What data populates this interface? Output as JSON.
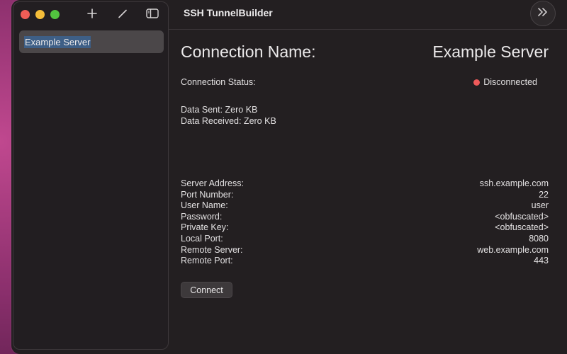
{
  "app": {
    "title": "SSH TunnelBuilder"
  },
  "sidebar": {
    "items": [
      {
        "label": "Example Server",
        "selected": true
      }
    ]
  },
  "detail": {
    "connection_name_label": "Connection Name:",
    "connection_name_value": "Example Server",
    "status_label": "Connection Status:",
    "status_value": "Disconnected",
    "status_color": "#ee5a5a",
    "data_sent": "Data Sent: Zero KB",
    "data_received": "Data Received: Zero KB",
    "fields": [
      {
        "label": "Server Address:",
        "value": "ssh.example.com"
      },
      {
        "label": "Port Number:",
        "value": "22"
      },
      {
        "label": "User Name:",
        "value": "user"
      },
      {
        "label": "Password:",
        "value": "<obfuscated>"
      },
      {
        "label": "Private Key:",
        "value": "<obfuscated>"
      },
      {
        "label": "Local Port:",
        "value": "8080"
      },
      {
        "label": "Remote Server:",
        "value": "web.example.com"
      },
      {
        "label": "Remote Port:",
        "value": "443"
      }
    ],
    "connect_label": "Connect"
  },
  "icons": {
    "add": "plus-icon",
    "edit": "pencil-icon",
    "sidebar_toggle": "sidebar-toggle-icon",
    "expand": "chevron-double-right-icon"
  }
}
